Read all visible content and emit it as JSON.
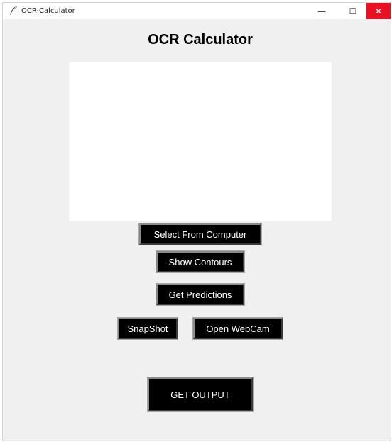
{
  "window": {
    "title": "OCR-Calculator",
    "minimize_glyph": "—",
    "maximize_glyph": "☐",
    "close_glyph": "✕",
    "close_color": "#e81123",
    "app_icon": "feather-icon"
  },
  "app": {
    "heading": "OCR Calculator"
  },
  "buttons": {
    "select_from_computer": "Select From Computer",
    "show_contours": "Show Contours",
    "get_predictions": "Get Predictions",
    "snapshot": "SnapShot",
    "open_webcam": "Open WebCam",
    "get_output": "GET OUTPUT"
  },
  "colors": {
    "window_bg": "#f0f0f0",
    "button_bg": "#000000",
    "button_text": "#ffffff"
  }
}
